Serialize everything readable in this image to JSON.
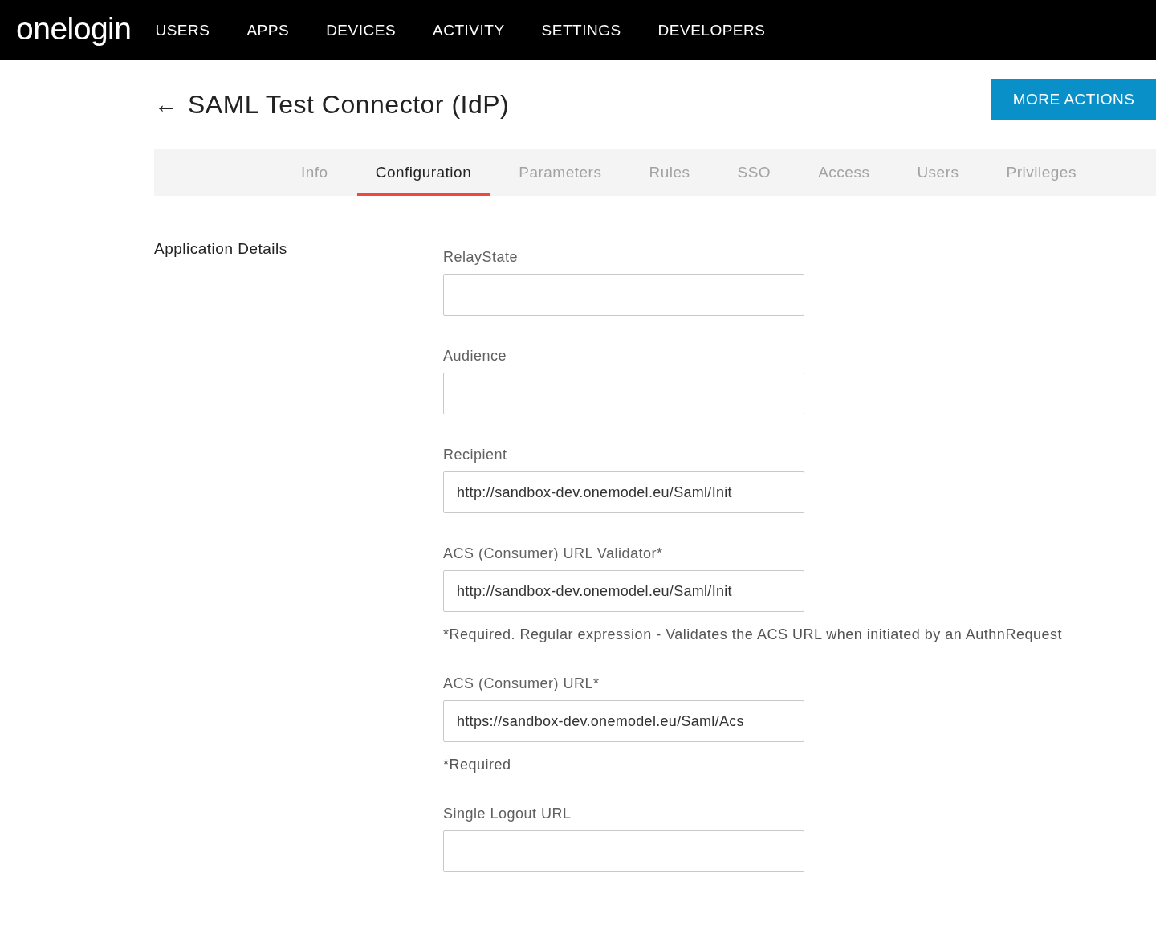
{
  "header": {
    "logo": "onelogin",
    "nav": [
      "USERS",
      "APPS",
      "DEVICES",
      "ACTIVITY",
      "SETTINGS",
      "DEVELOPERS"
    ]
  },
  "page": {
    "back": "←",
    "title": "SAML Test Connector (IdP)",
    "action": "MORE ACTIONS"
  },
  "tabs": [
    {
      "label": "Info",
      "selected": false
    },
    {
      "label": "Configuration",
      "selected": true
    },
    {
      "label": "Parameters",
      "selected": false
    },
    {
      "label": "Rules",
      "selected": false
    },
    {
      "label": "SSO",
      "selected": false
    },
    {
      "label": "Access",
      "selected": false
    },
    {
      "label": "Users",
      "selected": false
    },
    {
      "label": "Privileges",
      "selected": false
    }
  ],
  "section": {
    "title": "Application Details"
  },
  "fields": [
    {
      "label": "RelayState"
    },
    {
      "label": "Audience"
    },
    {
      "label": "Recipient",
      "value": "http://sandbox-dev.onemodel.eu/Saml/Init"
    },
    {
      "label": "ACS (Consumer) URL Validator*",
      "value": "http://sandbox-dev.onemodel.eu/Saml/Init",
      "note": "*Required. Regular expression - Validates the ACS URL when initiated by an AuthnRequest"
    },
    {
      "label": "ACS (Consumer) URL*",
      "value": "https://sandbox-dev.onemodel.eu/Saml/Acs",
      "note": "*Required"
    },
    {
      "label": "Single Logout URL"
    }
  ]
}
